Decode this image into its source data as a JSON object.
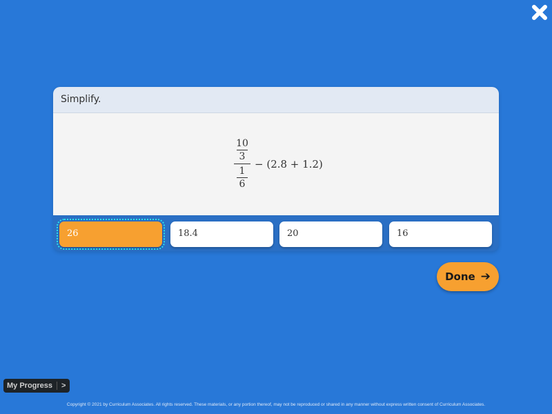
{
  "close_button": {
    "icon": "close-icon"
  },
  "question": {
    "prompt": "Simplify.",
    "expression": {
      "numerator": {
        "num": "10",
        "den": "3"
      },
      "denominator": {
        "num": "1",
        "den": "6"
      },
      "rest": "− (2.8 + 1.2)"
    }
  },
  "answers": [
    {
      "label": "26",
      "selected": true
    },
    {
      "label": "18.4",
      "selected": false
    },
    {
      "label": "20",
      "selected": false
    },
    {
      "label": "16",
      "selected": false
    }
  ],
  "done_button": {
    "label": "Done",
    "icon": "arrow-right-icon",
    "arrow": "➔"
  },
  "my_progress": {
    "label": "My Progress",
    "chevron": ">"
  },
  "footer": {
    "copyright": "Copyright © 2021 by Curriculum Associates. All rights reserved. These materials, or any portion thereof, may not be reproduced or shared in any manner without express written consent of Curriculum Associates."
  },
  "colors": {
    "background": "#2878d8",
    "accent_orange": "#f7a030",
    "focus_outline": "#27e3f0"
  }
}
